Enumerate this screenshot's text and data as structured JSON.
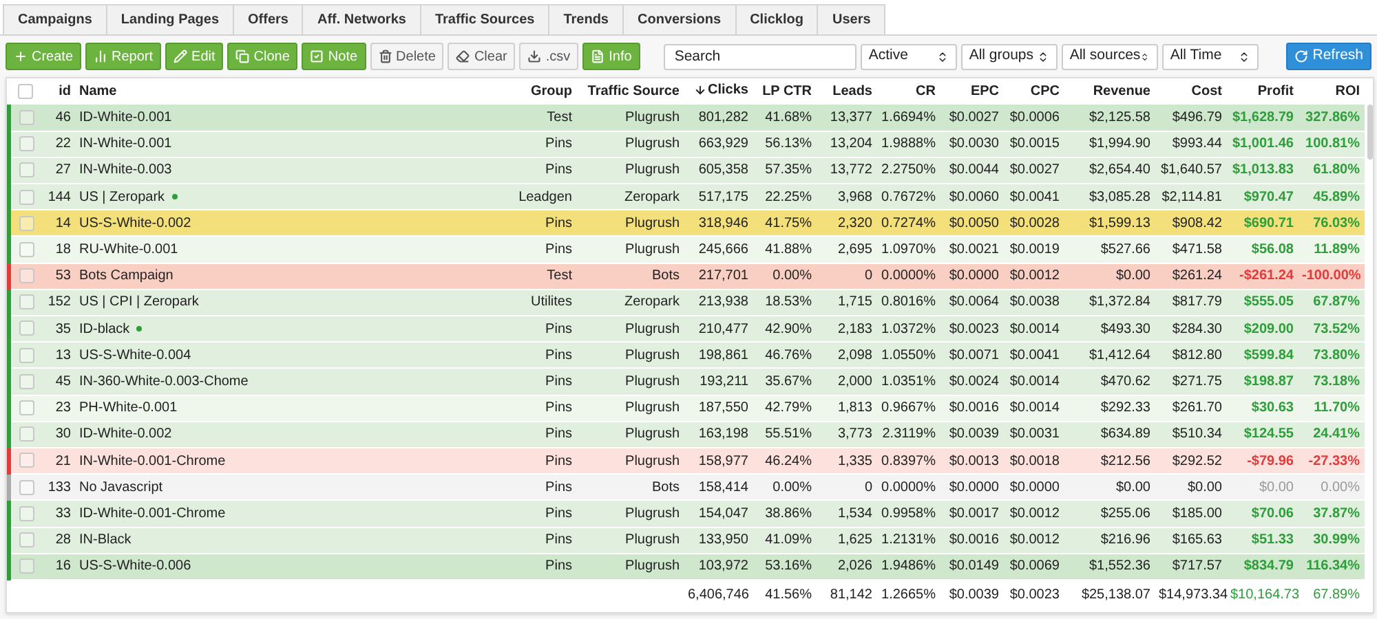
{
  "tabs": [
    {
      "label": "Campaigns"
    },
    {
      "label": "Landing Pages"
    },
    {
      "label": "Offers"
    },
    {
      "label": "Aff. Networks"
    },
    {
      "label": "Traffic Sources"
    },
    {
      "label": "Trends"
    },
    {
      "label": "Conversions"
    },
    {
      "label": "Clicklog"
    },
    {
      "label": "Users"
    }
  ],
  "toolbar": {
    "buttons": [
      {
        "label": "Create",
        "kind": "primary"
      },
      {
        "label": "Report",
        "kind": "primary"
      },
      {
        "label": "Edit",
        "kind": "primary"
      },
      {
        "label": "Clone",
        "kind": "primary"
      },
      {
        "label": "Note",
        "kind": "primary"
      },
      {
        "label": "Delete",
        "kind": "default"
      },
      {
        "label": "Clear",
        "kind": "default"
      },
      {
        "label": ".csv",
        "kind": "default"
      },
      {
        "label": "Info",
        "kind": "primary"
      }
    ],
    "search": {
      "placeholder": "Search"
    },
    "filters": [
      {
        "value": "Active"
      },
      {
        "value": "All groups"
      },
      {
        "value": "All sources"
      },
      {
        "value": "All Time"
      }
    ],
    "refresh": {
      "label": "Refresh"
    }
  },
  "table": {
    "select_all": {
      "checked": false
    },
    "columns": [
      {
        "label": "id",
        "sorted_desc": false
      },
      {
        "label": "Name",
        "sorted_desc": false
      },
      {
        "label": "Group",
        "sorted_desc": false
      },
      {
        "label": "Traffic Source",
        "sorted_desc": false
      },
      {
        "label": "Clicks",
        "sorted_desc": true
      },
      {
        "label": "LP CTR",
        "sorted_desc": false
      },
      {
        "label": "Leads",
        "sorted_desc": false
      },
      {
        "label": "CR",
        "sorted_desc": false
      },
      {
        "label": "EPC",
        "sorted_desc": false
      },
      {
        "label": "CPC",
        "sorted_desc": false
      },
      {
        "label": "Revenue",
        "sorted_desc": false
      },
      {
        "label": "Cost",
        "sorted_desc": false
      },
      {
        "label": "Profit",
        "sorted_desc": false
      },
      {
        "label": "ROI",
        "sorted_desc": false
      }
    ],
    "rows": [
      {
        "checked": false,
        "color": "#cfe7cc",
        "kind": "gain",
        "starred": false,
        "cells": [
          "46",
          "ID-White-0.001",
          "Test",
          "Plugrush",
          "801,282",
          "41.68%",
          "13,377",
          "1.6694%",
          "$0.0027",
          "$0.0006",
          "$2,125.58",
          "$496.79",
          "$1,628.79",
          "327.86%"
        ]
      },
      {
        "checked": false,
        "color": "#e1f0de",
        "kind": "gain",
        "starred": false,
        "cells": [
          "22",
          "IN-White-0.001",
          "Pins",
          "Plugrush",
          "663,929",
          "56.13%",
          "13,204",
          "1.9888%",
          "$0.0030",
          "$0.0015",
          "$1,994.90",
          "$993.44",
          "$1,001.46",
          "100.81%"
        ]
      },
      {
        "checked": false,
        "color": "#e1f0de",
        "kind": "gain",
        "starred": false,
        "cells": [
          "27",
          "IN-White-0.003",
          "Pins",
          "Plugrush",
          "605,358",
          "57.35%",
          "13,772",
          "2.2750%",
          "$0.0044",
          "$0.0027",
          "$2,654.40",
          "$1,640.57",
          "$1,013.83",
          "61.80%"
        ]
      },
      {
        "checked": false,
        "color": "#e1f0de",
        "kind": "gain",
        "starred": true,
        "cells": [
          "144",
          "US | Zeropark",
          "Leadgen",
          "Zeropark",
          "517,175",
          "22.25%",
          "3,968",
          "0.7672%",
          "$0.0060",
          "$0.0041",
          "$3,085.28",
          "$2,114.81",
          "$970.47",
          "45.89%"
        ]
      },
      {
        "checked": false,
        "color": "#f3e07a",
        "kind": "gain",
        "starred": false,
        "cells": [
          "14",
          "US-S-White-0.002",
          "Pins",
          "Plugrush",
          "318,946",
          "41.75%",
          "2,320",
          "0.7274%",
          "$0.0050",
          "$0.0028",
          "$1,599.13",
          "$908.42",
          "$690.71",
          "76.03%"
        ]
      },
      {
        "checked": false,
        "color": "#eff7ed",
        "kind": "gain",
        "starred": false,
        "cells": [
          "18",
          "RU-White-0.001",
          "Pins",
          "Plugrush",
          "245,666",
          "41.88%",
          "2,695",
          "1.0970%",
          "$0.0021",
          "$0.0019",
          "$527.66",
          "$471.58",
          "$56.08",
          "11.89%"
        ]
      },
      {
        "checked": false,
        "color": "#f9cfc3",
        "kind": "loss",
        "starred": false,
        "cells": [
          "53",
          "Bots Campaign",
          "Test",
          "Bots",
          "217,701",
          "0.00%",
          "0",
          "0.0000%",
          "$0.0000",
          "$0.0012",
          "$0.00",
          "$261.24",
          "-$261.24",
          "-100.00%"
        ]
      },
      {
        "checked": false,
        "color": "#e1f0de",
        "kind": "gain",
        "starred": false,
        "cells": [
          "152",
          "US | CPI | Zeropark",
          "Utilites",
          "Zeropark",
          "213,938",
          "18.53%",
          "1,715",
          "0.8016%",
          "$0.0064",
          "$0.0038",
          "$1,372.84",
          "$817.79",
          "$555.05",
          "67.87%"
        ]
      },
      {
        "checked": false,
        "color": "#e1f0de",
        "kind": "gain",
        "starred": true,
        "cells": [
          "35",
          "ID-black",
          "Pins",
          "Plugrush",
          "210,477",
          "42.90%",
          "2,183",
          "1.0372%",
          "$0.0023",
          "$0.0014",
          "$493.30",
          "$284.30",
          "$209.00",
          "73.52%"
        ]
      },
      {
        "checked": false,
        "color": "#e1f0de",
        "kind": "gain",
        "starred": false,
        "cells": [
          "13",
          "US-S-White-0.004",
          "Pins",
          "Plugrush",
          "198,861",
          "46.76%",
          "2,098",
          "1.0550%",
          "$0.0071",
          "$0.0041",
          "$1,412.64",
          "$812.80",
          "$599.84",
          "73.80%"
        ]
      },
      {
        "checked": false,
        "color": "#e1f0de",
        "kind": "gain",
        "starred": false,
        "cells": [
          "45",
          "IN-360-White-0.003-Chome",
          "Pins",
          "Plugrush",
          "193,211",
          "35.67%",
          "2,000",
          "1.0351%",
          "$0.0024",
          "$0.0014",
          "$470.62",
          "$271.75",
          "$198.87",
          "73.18%"
        ]
      },
      {
        "checked": false,
        "color": "#eff7ed",
        "kind": "gain",
        "starred": false,
        "cells": [
          "23",
          "PH-White-0.001",
          "Pins",
          "Plugrush",
          "187,550",
          "42.79%",
          "1,813",
          "0.9667%",
          "$0.0016",
          "$0.0014",
          "$292.33",
          "$261.70",
          "$30.63",
          "11.70%"
        ]
      },
      {
        "checked": false,
        "color": "#e1f0de",
        "kind": "gain",
        "starred": false,
        "cells": [
          "30",
          "ID-White-0.002",
          "Pins",
          "Plugrush",
          "163,198",
          "55.51%",
          "3,773",
          "2.3119%",
          "$0.0039",
          "$0.0031",
          "$634.89",
          "$510.34",
          "$124.55",
          "24.41%"
        ]
      },
      {
        "checked": false,
        "color": "#fce1dc",
        "kind": "loss",
        "starred": false,
        "cells": [
          "21",
          "IN-White-0.001-Chrome",
          "Pins",
          "Plugrush",
          "158,977",
          "46.24%",
          "1,335",
          "0.8397%",
          "$0.0013",
          "$0.0018",
          "$212.56",
          "$292.52",
          "-$79.96",
          "-27.33%"
        ]
      },
      {
        "checked": false,
        "color": "#f3f3f3",
        "kind": "even",
        "starred": false,
        "cells": [
          "133",
          "No Javascript",
          "Pins",
          "Bots",
          "158,414",
          "0.00%",
          "0",
          "0.0000%",
          "$0.0000",
          "$0.0000",
          "$0.00",
          "$0.00",
          "$0.00",
          "0.00%"
        ]
      },
      {
        "checked": false,
        "color": "#e1f0de",
        "kind": "gain",
        "starred": false,
        "cells": [
          "33",
          "ID-White-0.001-Chrome",
          "Pins",
          "Plugrush",
          "154,047",
          "38.86%",
          "1,534",
          "0.9958%",
          "$0.0017",
          "$0.0012",
          "$255.06",
          "$185.00",
          "$70.06",
          "37.87%"
        ]
      },
      {
        "checked": false,
        "color": "#e1f0de",
        "kind": "gain",
        "starred": false,
        "cells": [
          "28",
          "IN-Black",
          "Pins",
          "Plugrush",
          "133,950",
          "41.09%",
          "1,625",
          "1.2131%",
          "$0.0016",
          "$0.0012",
          "$216.96",
          "$165.63",
          "$51.33",
          "30.99%"
        ]
      },
      {
        "checked": false,
        "color": "#cfe7cc",
        "kind": "gain",
        "starred": false,
        "cells": [
          "16",
          "US-S-White-0.006",
          "Pins",
          "Plugrush",
          "103,972",
          "53.16%",
          "2,026",
          "1.9486%",
          "$0.0149",
          "$0.0069",
          "$1,552.36",
          "$717.57",
          "$834.79",
          "116.34%"
        ]
      }
    ],
    "totals": [
      "6,406,746",
      "41.56%",
      "81,142",
      "1.2665%",
      "$0.0039",
      "$0.0023",
      "$25,138.07",
      "$14,973.34",
      "$10,164.73",
      "67.89%"
    ]
  }
}
